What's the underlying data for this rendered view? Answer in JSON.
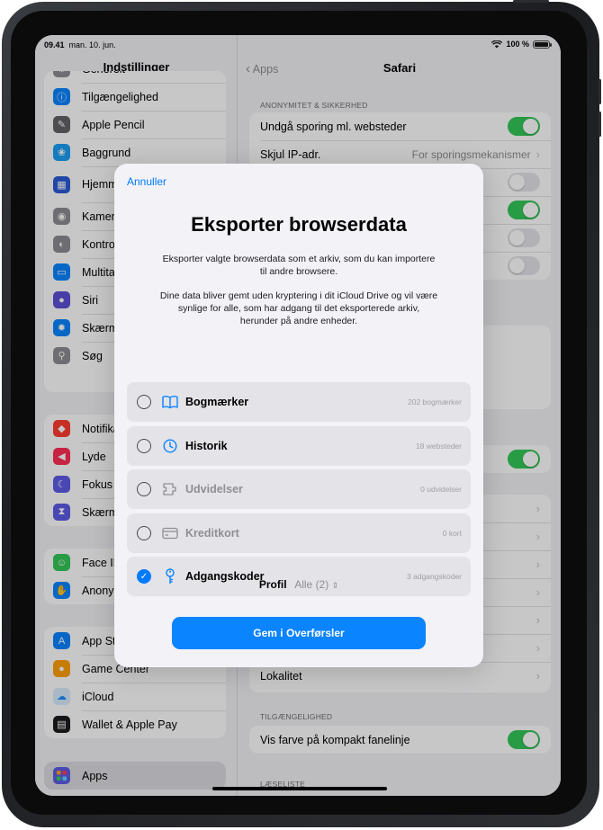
{
  "status_bar": {
    "time": "09.41",
    "date": "man. 10. jun.",
    "battery": "100 %"
  },
  "sidebar": {
    "title": "Indstillinger",
    "group1": [
      {
        "label": "Generelt",
        "color": "#8e8e93",
        "icon": "gear-icon"
      },
      {
        "label": "Tilgængelighed",
        "color": "#0a84ff",
        "icon": "accessibility-icon"
      },
      {
        "label": "Apple Pencil",
        "color": "#636366",
        "icon": "pencil-icon"
      },
      {
        "label": "Baggrund",
        "color": "#1a9ff5",
        "icon": "flower-icon"
      },
      {
        "label": "Hjemme-skærm og appbibliotek",
        "color": "#2a5ad6",
        "icon": "home-screen-icon"
      },
      {
        "label": "Kamera",
        "color": "#8e8e93",
        "icon": "camera-icon"
      },
      {
        "label": "Kontrolcenter",
        "color": "#8e8e93",
        "icon": "control-center-icon"
      },
      {
        "label": "Multitasking",
        "color": "#0a84ff",
        "icon": "multitask-icon"
      },
      {
        "label": "Siri",
        "color": "#5e4fd6",
        "icon": "siri-icon"
      },
      {
        "label": "Skærm",
        "color": "#0a84ff",
        "icon": "sun-icon"
      },
      {
        "label": "Søg",
        "color": "#8e8e93",
        "icon": "search-icon"
      }
    ],
    "group2": [
      {
        "label": "Notifikationer",
        "color": "#ff3b30",
        "icon": "bell-icon"
      },
      {
        "label": "Lyde",
        "color": "#ff2d55",
        "icon": "speaker-icon"
      },
      {
        "label": "Fokus",
        "color": "#5e5ce6",
        "icon": "moon-icon"
      },
      {
        "label": "Skærmtid",
        "color": "#5e5ce6",
        "icon": "hourglass-icon"
      }
    ],
    "group3": [
      {
        "label": "Face ID",
        "color": "#34c759",
        "icon": "face-id-icon"
      },
      {
        "label": "Anonymitet",
        "color": "#0a84ff",
        "icon": "hand-icon"
      }
    ],
    "group4": [
      {
        "label": "App Store",
        "color": "#0a84ff",
        "icon": "app-store-icon"
      },
      {
        "label": "Game Center",
        "color": "#ff9f0a",
        "icon": "game-center-icon"
      },
      {
        "label": "iCloud",
        "color": "#d9ecfb",
        "icon": "cloud-icon"
      },
      {
        "label": "Wallet & Apple Pay",
        "color": "#1c1c1e",
        "icon": "wallet-icon"
      }
    ],
    "apps_label": "Apps"
  },
  "detail": {
    "back_label": "Apps",
    "title": "Safari",
    "section_privacy": "ANONYMITET & SIKKERHED",
    "row_tracking": "Undgå sporing ml. websteder",
    "row_hide_ip": "Skjul IP-adr.",
    "row_hide_ip_value": "For sporingsmekanismer",
    "row_location": "Lokalitet",
    "section_accessibility": "TILGÆNGELIGHED",
    "row_color": "Vis farve på kompakt fanelinje",
    "section_reading": "LÆSELISTE"
  },
  "sheet": {
    "cancel": "Annuller",
    "title": "Eksporter browserdata",
    "desc1": "Eksporter valgte browserdata som et arkiv, som du kan importere til andre browsere.",
    "desc2": "Dine data bliver gemt uden kryptering i dit iCloud Drive og vil være synlige for alle, som har adgang til det eksporterede arkiv, herunder på andre enheder.",
    "options": [
      {
        "label": "Bogmærker",
        "count": "202 bogmærker",
        "checked": false,
        "disabled": false,
        "icon": "book-icon"
      },
      {
        "label": "Historik",
        "count": "18 websteder",
        "checked": false,
        "disabled": false,
        "icon": "clock-icon"
      },
      {
        "label": "Udvidelser",
        "count": "0 udvidelser",
        "checked": false,
        "disabled": true,
        "icon": "puzzle-icon"
      },
      {
        "label": "Kreditkort",
        "count": "0 kort",
        "checked": false,
        "disabled": true,
        "icon": "credit-card-icon"
      },
      {
        "label": "Adgangskoder",
        "count": "3 adgangskoder",
        "checked": true,
        "disabled": false,
        "icon": "key-icon"
      }
    ],
    "profile_label": "Profil",
    "profile_value": "Alle (2)",
    "save_button": "Gem i Overførsler"
  }
}
